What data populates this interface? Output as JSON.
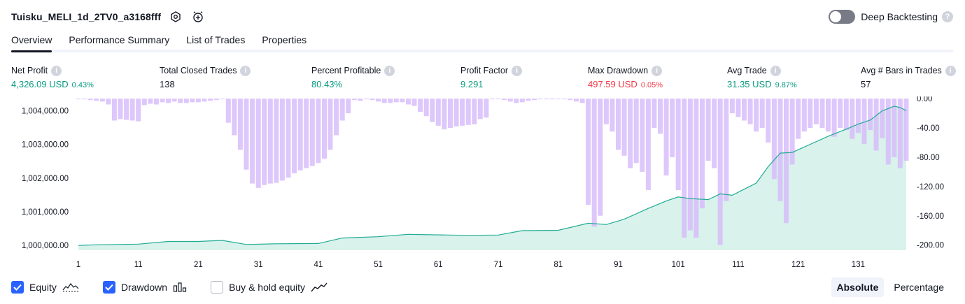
{
  "header": {
    "strategy_name": "Tuisku_MELI_1d_2TV0_a3168fff",
    "deep_backtesting_label": "Deep Backtesting",
    "icons": [
      "settings-icon",
      "alarm-add-icon",
      "help-icon"
    ]
  },
  "tabs": [
    {
      "label": "Overview",
      "active": true
    },
    {
      "label": "Performance Summary",
      "active": false
    },
    {
      "label": "List of Trades",
      "active": false
    },
    {
      "label": "Properties",
      "active": false
    }
  ],
  "metrics": [
    {
      "label": "Net Profit",
      "value": "4,326.09 USD",
      "pct": "0.43%",
      "tone": "pos"
    },
    {
      "label": "Total Closed Trades",
      "value": "138",
      "pct": "",
      "tone": "neutral"
    },
    {
      "label": "Percent Profitable",
      "value": "80.43%",
      "pct": "",
      "tone": "pos"
    },
    {
      "label": "Profit Factor",
      "value": "9.291",
      "pct": "",
      "tone": "pos"
    },
    {
      "label": "Max Drawdown",
      "value": "497.59 USD",
      "pct": "0.05%",
      "tone": "neg"
    },
    {
      "label": "Avg Trade",
      "value": "31.35 USD",
      "pct": "9.87%",
      "tone": "pos"
    },
    {
      "label": "Avg # Bars in Trades",
      "value": "57",
      "pct": "",
      "tone": "neutral"
    }
  ],
  "legend": {
    "equity": {
      "label": "Equity",
      "checked": true
    },
    "drawdown": {
      "label": "Drawdown",
      "checked": true
    },
    "buy_hold": {
      "label": "Buy & hold equity",
      "checked": false
    }
  },
  "mode": {
    "absolute_label": "Absolute",
    "percentage_label": "Percentage",
    "active": "Absolute"
  },
  "colors": {
    "equity_line": "#22ab94",
    "equity_fill": "#d9f2ec",
    "drawdown_bar": "#d7bdfa",
    "positive": "#089981",
    "negative": "#f23645",
    "checkbox": "#2962ff"
  },
  "chart_data": {
    "type": "area",
    "x_ticks": [
      "1",
      "11",
      "21",
      "31",
      "41",
      "51",
      "61",
      "71",
      "81",
      "91",
      "101",
      "111",
      "121",
      "131"
    ],
    "left_axis_ticks": [
      "1,004,000.00",
      "1,003,000.00",
      "1,002,000.00",
      "1,001,000.00",
      "1,000,000.00"
    ],
    "right_axis_ticks": [
      "0.00",
      "-40.00",
      "-80.00",
      "-120.00",
      "-160.00",
      "-200.00"
    ],
    "equity_ylim": [
      999860,
      1004420
    ],
    "drawdown_ylim": [
      -207,
      3
    ],
    "equity_series": {
      "x": [
        1,
        4,
        11,
        16,
        21,
        25,
        29,
        34,
        41,
        45,
        51,
        56,
        66,
        71,
        75,
        81,
        86,
        89,
        92,
        96,
        99,
        101,
        103,
        106,
        108,
        110,
        112,
        114,
        116,
        118,
        120,
        123,
        126,
        129,
        131,
        133,
        135,
        137,
        138,
        139
      ],
      "values": [
        1000000,
        1000020,
        1000040,
        1000120,
        1000120,
        1000150,
        1000030,
        1000050,
        1000060,
        1000220,
        1000260,
        1000330,
        1000300,
        1000310,
        1000440,
        1000450,
        1000660,
        1000620,
        1000780,
        1001100,
        1001320,
        1001440,
        1001390,
        1001360,
        1001530,
        1001490,
        1001670,
        1001850,
        1002340,
        1002740,
        1002760,
        1003000,
        1003240,
        1003450,
        1003600,
        1003720,
        1003990,
        1004130,
        1004090,
        1004000
      ]
    },
    "drawdown_series": {
      "x": [
        1,
        2,
        3,
        4,
        5,
        6,
        7,
        8,
        9,
        10,
        11,
        12,
        13,
        14,
        15,
        16,
        17,
        18,
        19,
        20,
        21,
        22,
        23,
        24,
        25,
        26,
        27,
        28,
        29,
        30,
        31,
        32,
        33,
        34,
        35,
        36,
        37,
        38,
        39,
        40,
        41,
        42,
        43,
        44,
        45,
        46,
        47,
        48,
        49,
        50,
        51,
        52,
        53,
        54,
        55,
        56,
        57,
        58,
        59,
        60,
        61,
        62,
        63,
        64,
        65,
        66,
        67,
        68,
        69,
        70,
        71,
        72,
        73,
        74,
        75,
        76,
        77,
        78,
        79,
        80,
        81,
        82,
        83,
        84,
        85,
        86,
        87,
        88,
        89,
        90,
        91,
        92,
        93,
        94,
        95,
        96,
        97,
        98,
        99,
        100,
        101,
        102,
        103,
        104,
        105,
        106,
        107,
        108,
        109,
        110,
        111,
        112,
        113,
        114,
        115,
        116,
        117,
        118,
        119,
        120,
        121,
        122,
        123,
        124,
        125,
        126,
        127,
        128,
        129,
        130,
        131,
        132,
        133,
        134,
        135,
        136,
        137,
        138,
        139
      ],
      "values": [
        0,
        -1,
        -2,
        -3,
        -4,
        -8,
        -30,
        -28,
        -29,
        -30,
        -31,
        -9,
        -7,
        -8,
        -5,
        -6,
        -4,
        -6,
        -6,
        -5,
        -5,
        -4,
        -3,
        -2,
        -1,
        -33,
        -50,
        -70,
        -97,
        -116,
        -122,
        -118,
        -116,
        -115,
        -112,
        -108,
        -102,
        -98,
        -95,
        -92,
        -88,
        -82,
        -70,
        -50,
        -30,
        -20,
        -2,
        -3,
        -1,
        -2,
        -4,
        -6,
        -6,
        -5,
        -5,
        -8,
        -10,
        -18,
        -24,
        -32,
        -37,
        -42,
        -40,
        -38,
        -37,
        -36,
        -35,
        -28,
        -26,
        -1,
        -1,
        -2,
        -4,
        -6,
        -5,
        -3,
        -2,
        -1,
        -1,
        -1,
        0,
        0,
        -2,
        -4,
        -6,
        -145,
        -175,
        -160,
        -35,
        -45,
        -70,
        -78,
        -95,
        -88,
        -100,
        -125,
        -40,
        -48,
        -105,
        -80,
        -125,
        -190,
        -180,
        -190,
        -150,
        -85,
        -95,
        -200,
        -140,
        -20,
        -25,
        -30,
        -35,
        -45,
        -40,
        -60,
        -110,
        -140,
        -170,
        -90,
        -55,
        -45,
        -40,
        -35,
        -40,
        -45,
        -52,
        -40,
        -43,
        -55,
        -47,
        -62,
        -43,
        -71,
        -54,
        -90,
        -80,
        -95,
        -85
      ]
    }
  }
}
